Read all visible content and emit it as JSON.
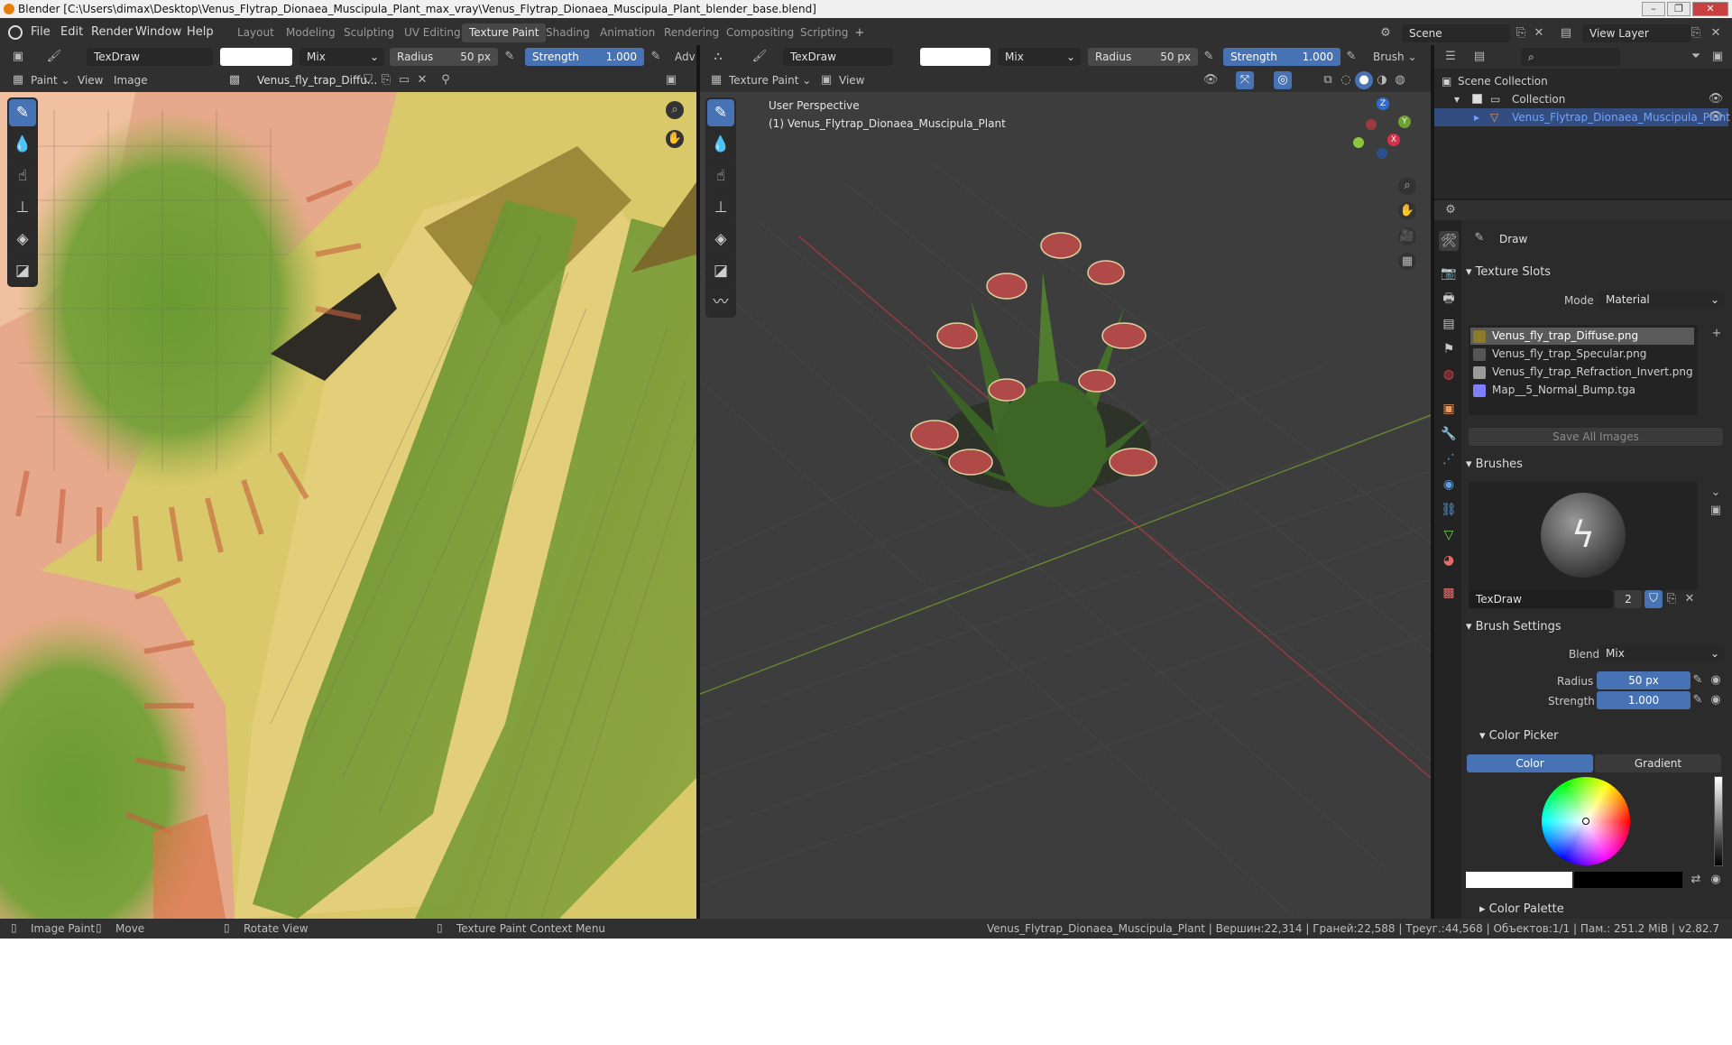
{
  "window": {
    "title": "Blender [C:\\Users\\dimax\\Desktop\\Venus_Flytrap_Dionaea_Muscipula_Plant_max_vray\\Venus_Flytrap_Dionaea_Muscipula_Plant_blender_base.blend]"
  },
  "menu": {
    "file": "File",
    "edit": "Edit",
    "render": "Render",
    "window": "Window",
    "help": "Help"
  },
  "workspaces": [
    "Layout",
    "Modeling",
    "Sculpting",
    "UV Editing",
    "Texture Paint",
    "Shading",
    "Animation",
    "Rendering",
    "Compositing",
    "Scripting"
  ],
  "active_workspace": "Texture Paint",
  "scene": {
    "name": "Scene",
    "view_layer": "View Layer"
  },
  "image_editor": {
    "brush_name": "TexDraw",
    "blend": "Mix",
    "radius_label": "Radius",
    "radius_value": "50 px",
    "strength_label": "Strength",
    "strength_value": "1.000",
    "advanced": "Adv",
    "mode": "Paint",
    "view": "View",
    "image": "Image",
    "image_name": "Venus_fly_trap_Diffu..."
  },
  "viewport": {
    "brush_name": "TexDraw",
    "blend": "Mix",
    "radius_label": "Radius",
    "radius_value": "50 px",
    "strength_label": "Strength",
    "strength_value": "1.000",
    "brush_menu": "Brush",
    "mode": "Texture Paint",
    "view": "View",
    "perspective": "User Perspective",
    "object_label": "(1) Venus_Flytrap_Dionaea_Muscipula_Plant",
    "gizmo": {
      "z": "Z",
      "y": "Y",
      "x": "X"
    }
  },
  "outliner": {
    "scene_collection": "Scene Collection",
    "collection": "Collection",
    "object": "Venus_Flytrap_Dionaea_Muscipula_Plant"
  },
  "properties": {
    "tool_name": "Draw",
    "texture_slots": {
      "title": "Texture Slots",
      "mode_label": "Mode",
      "mode_value": "Material",
      "slots": [
        {
          "name": "Venus_fly_trap_Diffuse.png",
          "color": "#8a7a2a"
        },
        {
          "name": "Venus_fly_trap_Specular.png",
          "color": "#555555"
        },
        {
          "name": "Venus_fly_trap_Refraction_Invert.png",
          "color": "#9a9a9a"
        },
        {
          "name": "Map__5_Normal_Bump.tga",
          "color": "#8080ff"
        }
      ],
      "save_all": "Save All Images"
    },
    "brushes": {
      "title": "Brushes",
      "brush_name": "TexDraw",
      "users": "2"
    },
    "brush_settings": {
      "title": "Brush Settings",
      "blend_label": "Blend",
      "blend_value": "Mix",
      "radius_label": "Radius",
      "radius_value": "50 px",
      "strength_label": "Strength",
      "strength_value": "1.000"
    },
    "color_picker": {
      "title": "Color Picker",
      "tab_color": "Color",
      "tab_gradient": "Gradient"
    },
    "color_palette": {
      "title": "Color Palette"
    }
  },
  "statusbar": {
    "image_paint": "Image Paint",
    "move": "Move",
    "rotate_view": "Rotate View",
    "context_menu": "Texture Paint Context Menu",
    "stats": "Venus_Flytrap_Dionaea_Muscipula_Plant | Вершин:22,314 | Граней:22,588 | Треуг.:44,568 | Объектов:1/1 | Пам.: 251.2 MiB | v2.82.7"
  },
  "colors": {
    "accent": "#4772b3",
    "selection": "#5680c2",
    "bg": "#303030"
  }
}
